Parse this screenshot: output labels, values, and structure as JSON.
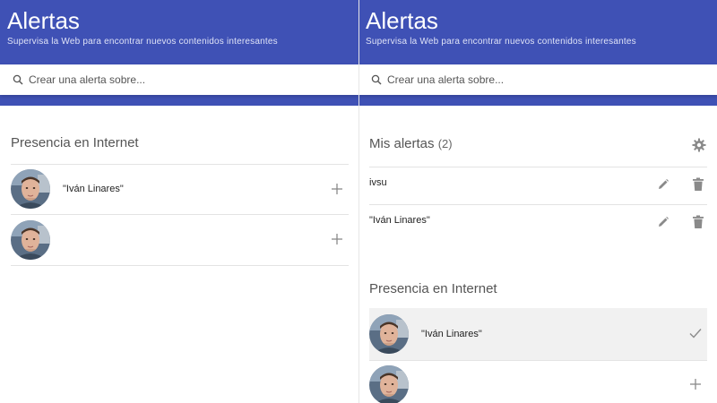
{
  "left": {
    "header": {
      "title": "Alertas",
      "subtitle": "Supervisa la Web para encontrar nuevos contenidos interesantes"
    },
    "search": {
      "placeholder": "Crear una alerta sobre..."
    },
    "presence": {
      "title": "Presencia en Internet",
      "items": [
        {
          "label": "\"Iván Linares\"",
          "action": "add-icon"
        },
        {
          "label": "",
          "action": "add-icon"
        }
      ]
    }
  },
  "right": {
    "header": {
      "title": "Alertas",
      "subtitle": "Supervisa la Web para encontrar nuevos contenidos interesantes"
    },
    "search": {
      "placeholder": "Crear una alerta sobre..."
    },
    "my_alerts": {
      "title": "Mis alertas",
      "count": "(2)",
      "items": [
        {
          "label": "ivsu"
        },
        {
          "label": "\"Iván Linares\""
        }
      ]
    },
    "presence": {
      "title": "Presencia en Internet",
      "items": [
        {
          "label": "\"Iván Linares\"",
          "action": "check-icon",
          "selected": true
        },
        {
          "label": "",
          "action": "add-icon"
        }
      ]
    }
  },
  "colors": {
    "header_bg": "#3f51b5",
    "selected_row_bg": "#f1f1f1",
    "icon_gray": "#8a8a8a"
  }
}
